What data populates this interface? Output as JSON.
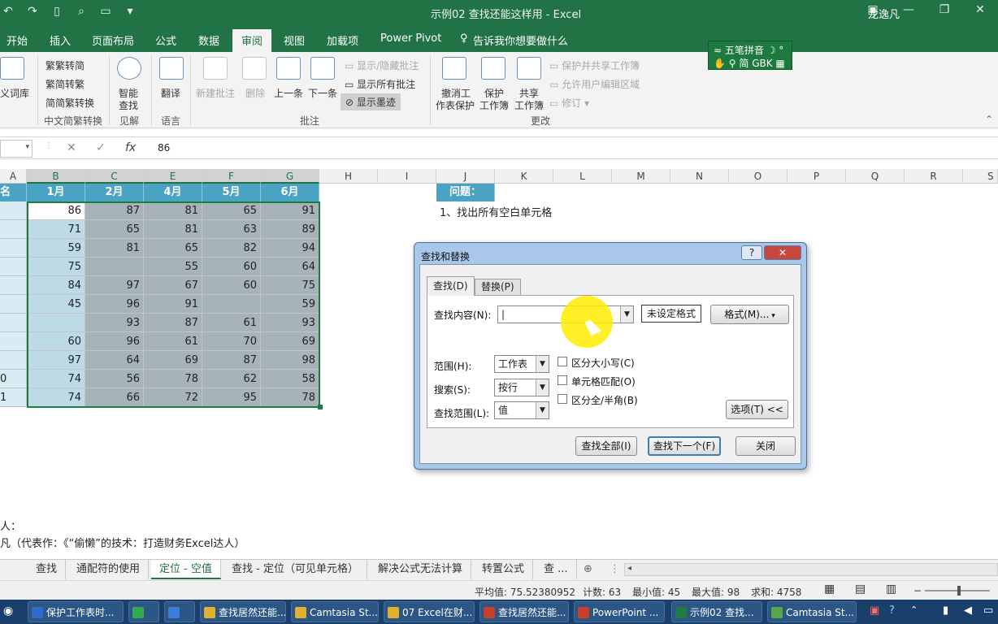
{
  "window": {
    "title": "示例02 查找还能这样用 - Excel",
    "user": "龙逸凡",
    "qat_icons": [
      "undo-icon",
      "redo-icon",
      "new-file-icon",
      "print-preview-icon",
      "screenshot-icon",
      "customize-icon"
    ]
  },
  "tabs": [
    "开始",
    "插入",
    "页面布局",
    "公式",
    "数据",
    "审阅",
    "视图",
    "加载项",
    "Power Pivot",
    "告诉我你想要做什么"
  ],
  "active_tab": "审阅",
  "ribbon": {
    "dict": "义词库",
    "chinese": {
      "to_trad": "繁转简",
      "to_simp": "简转繁",
      "convert": "简繁转换",
      "group": "中文简繁转换"
    },
    "smart": {
      "label1": "智能",
      "label2": "查找",
      "group": "见解"
    },
    "translate": {
      "label": "翻译",
      "group": "语言"
    },
    "comments": {
      "new": "新建批注",
      "delete": "删除",
      "prev": "上一条",
      "next": "下一条",
      "show_hide": "显示/隐藏批注",
      "show_all": "显示所有批注",
      "show_ink": "显示墨迹",
      "group": "批注"
    },
    "changes": {
      "unprotect1": "撤消工",
      "unprotect2": "作表保护",
      "protect1": "保护",
      "protect2": "工作簿",
      "share1": "共享",
      "share2": "工作簿",
      "protect_share": "保护并共享工作簿",
      "allow_edit": "允许用户编辑区域",
      "track": "修订",
      "group": "更改"
    }
  },
  "ime": {
    "line1": "五笔拼音",
    "line2": "简 GBK"
  },
  "formula_bar": {
    "value": "86",
    "fx": "fx"
  },
  "columns": [
    "A",
    "B",
    "C",
    "E",
    "F",
    "G",
    "H",
    "I",
    "J",
    "K",
    "L",
    "M",
    "N",
    "O",
    "P",
    "Q",
    "R",
    "S"
  ],
  "table": {
    "first_header_fragment": "名",
    "headers": [
      "1月",
      "2月",
      "4月",
      "5月",
      "6月"
    ],
    "rows": [
      [
        "86",
        "87",
        "81",
        "65",
        "91"
      ],
      [
        "71",
        "65",
        "81",
        "63",
        "89"
      ],
      [
        "59",
        "81",
        "65",
        "82",
        "94"
      ],
      [
        "75",
        "",
        "55",
        "60",
        "64"
      ],
      [
        "84",
        "97",
        "67",
        "60",
        "75"
      ],
      [
        "45",
        "96",
        "91",
        "",
        "59"
      ],
      [
        "",
        "93",
        "87",
        "61",
        "93"
      ],
      [
        "60",
        "96",
        "61",
        "70",
        "69"
      ],
      [
        "97",
        "64",
        "69",
        "87",
        "98"
      ],
      [
        "74",
        "56",
        "78",
        "62",
        "58"
      ],
      [
        "74",
        "66",
        "72",
        "95",
        "78"
      ]
    ],
    "row_fragments": [
      "",
      "",
      "",
      "",
      "",
      "",
      "",
      "",
      "",
      "0",
      "1"
    ]
  },
  "question": {
    "header": "问题：",
    "item1": "1、找出所有空白单元格"
  },
  "notes": {
    "line1": "人：",
    "line2": "凡（代表作：《“偷懒”的技术：打造财务Excel达人）"
  },
  "dialog": {
    "title": "查找和替换",
    "help": "?",
    "close_x": "✕",
    "tab_find": "查找(D)",
    "tab_replace": "替换(P)",
    "find_what_label": "查找内容(N):",
    "find_what_value": "",
    "format_status": "未设定格式",
    "format_button": "格式(M)...",
    "within_label": "范围(H):",
    "within_value": "工作表",
    "search_label": "搜索(S):",
    "search_value": "按行",
    "lookin_label": "查找范围(L):",
    "lookin_value": "值",
    "match_case": "区分大小写(C)",
    "match_entire": "单元格匹配(O)",
    "match_byte": "区分全/半角(B)",
    "options_button": "选项(T) <<",
    "find_all": "查找全部(I)",
    "find_next": "查找下一个(F)",
    "close": "关闭"
  },
  "sheet_tabs": [
    "查找",
    "通配符的使用",
    "定位 - 空值",
    "查找 - 定位（可见单元格）",
    "解决公式无法计算",
    "转置公式",
    "查 ..."
  ],
  "active_sheet": "定位 - 空值",
  "status": {
    "average": "平均值: 75.52380952",
    "count": "计数: 63",
    "min": "最小值: 45",
    "max": "最大值: 98",
    "sum": "求和: 4758"
  },
  "taskbar": [
    {
      "label": "保护工作表时...",
      "color": "#2f6cc8"
    },
    {
      "label": "",
      "color": "#34a853"
    },
    {
      "label": "",
      "color": "#3b7dd8"
    },
    {
      "label": "查找居然还能...",
      "color": "#e0b030"
    },
    {
      "label": "Camtasia St...",
      "color": "#e0b030"
    },
    {
      "label": "07 Excel在财...",
      "color": "#e0b030"
    },
    {
      "label": "查找居然还能...",
      "color": "#c8402a"
    },
    {
      "label": "PowerPoint ...",
      "color": "#c8402a"
    },
    {
      "label": "示例02 查找...",
      "color": "#1f7a43"
    },
    {
      "label": "Camtasia St...",
      "color": "#57a845"
    }
  ],
  "colors": {
    "excel_green": "#217346",
    "header_blue": "#4aa3c2",
    "selection": "#1f7a43"
  }
}
